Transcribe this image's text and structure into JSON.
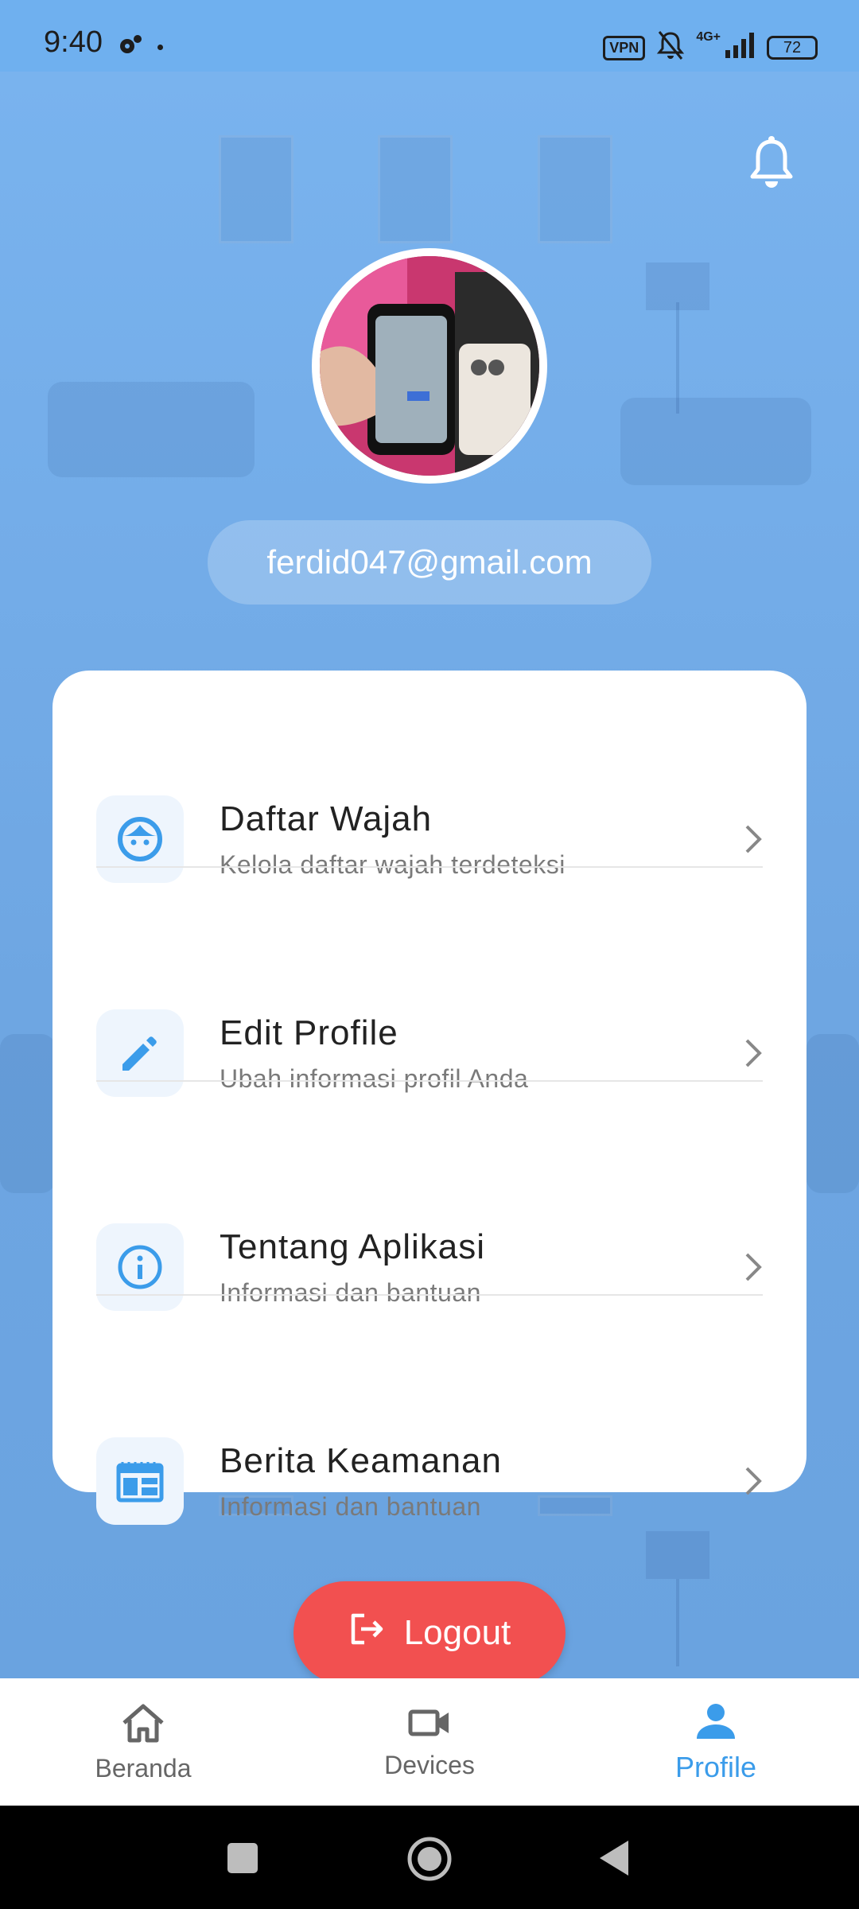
{
  "status_bar": {
    "time": "9:40",
    "vpn": "VPN",
    "network": "4G+",
    "battery": "72"
  },
  "profile": {
    "email": "ferdid047@gmail.com"
  },
  "menu": {
    "items": [
      {
        "title": "Daftar Wajah",
        "subtitle": "Kelola daftar wajah terdeteksi",
        "icon": "face-icon"
      },
      {
        "title": "Edit Profile",
        "subtitle": "Ubah informasi profil Anda",
        "icon": "pencil-icon"
      },
      {
        "title": "Tentang Aplikasi",
        "subtitle": "Informasi dan bantuan",
        "icon": "info-icon"
      },
      {
        "title": "Berita Keamanan",
        "subtitle": "Informasi dan bantuan",
        "icon": "news-icon"
      }
    ]
  },
  "logout_label": "Logout",
  "bottom_nav": {
    "items": [
      {
        "label": "Beranda",
        "icon": "home-icon"
      },
      {
        "label": "Devices",
        "icon": "video-camera-icon"
      },
      {
        "label": "Profile",
        "icon": "person-icon"
      }
    ],
    "active": "Profile"
  },
  "colors": {
    "accent": "#3b9cea",
    "logout": "#f25050",
    "background": "#6fa9ea"
  }
}
